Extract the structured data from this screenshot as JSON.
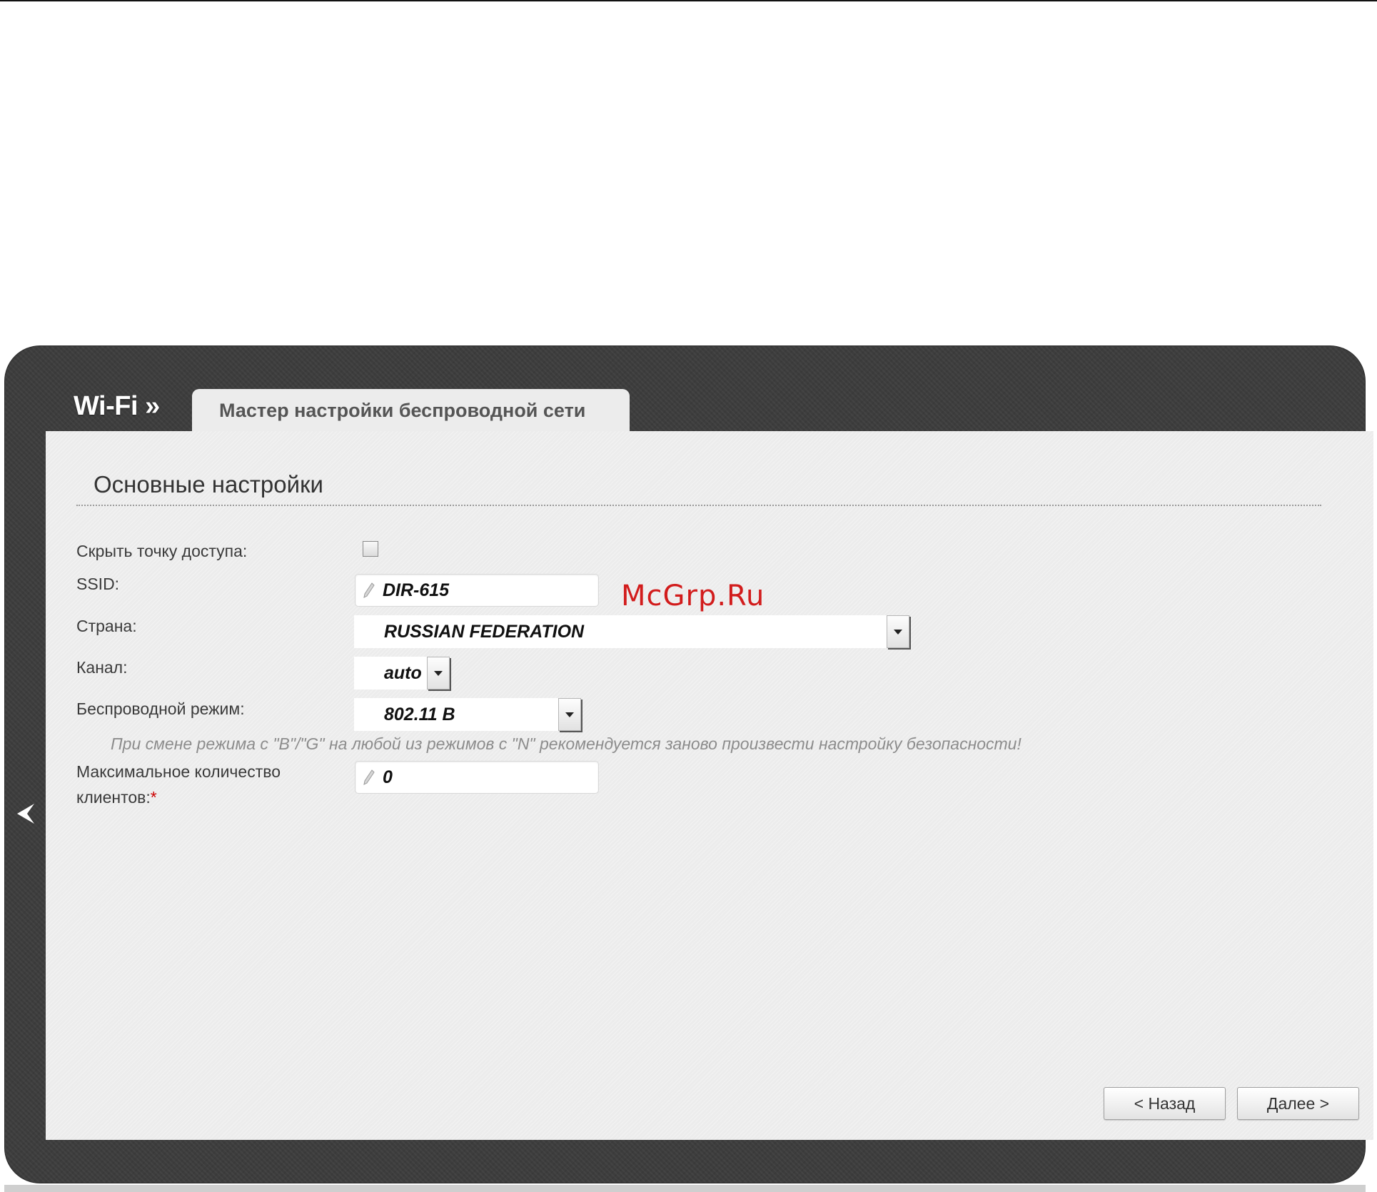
{
  "header": {
    "section_title": "Wi-Fi »",
    "tab_label": "Мастер настройки беспроводной сети"
  },
  "panel": {
    "heading": "Основные настройки"
  },
  "form": {
    "hide_ap": {
      "label": "Скрыть точку доступа:",
      "checked": false
    },
    "ssid": {
      "label": "SSID:",
      "value": "DIR-615"
    },
    "country": {
      "label": "Страна:",
      "value": "RUSSIAN FEDERATION"
    },
    "channel": {
      "label": "Канал:",
      "value": "auto"
    },
    "wireless_mode": {
      "label": "Беспроводной режим:",
      "value": "802.11 B",
      "hint": "При смене режима с \"B\"/\"G\" на любой из режимов с \"N\" рекомендуется заново произвести настройку безопасности!"
    },
    "max_clients": {
      "label_line1": "Максимальное количество",
      "label_line2": "клиентов:",
      "required_mark": "*",
      "value": "0"
    }
  },
  "buttons": {
    "back_label": "< Назад",
    "next_label": "Далее >"
  },
  "watermark": "McGrp.Ru",
  "icons": {
    "side_nav": "chevron-left-icon",
    "field_edit": "pencil-icon",
    "dropdown": "triangle-down-icon"
  },
  "colors": {
    "frame": "#3d3d3d",
    "panel": "#ececec",
    "watermark": "#d21c1c",
    "required": "#cc0000"
  }
}
